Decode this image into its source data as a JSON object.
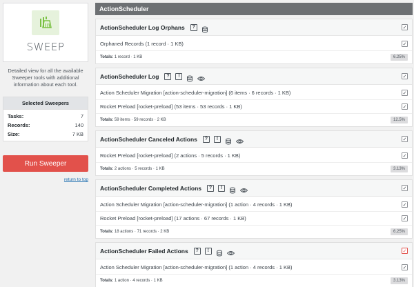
{
  "sidebar": {
    "logo_text": "SWEEP",
    "description": "Detailed view for all the available Sweeper tools with additional information about each tool.",
    "selected_title": "Selected Sweepers",
    "stats": [
      {
        "label": "Tasks:",
        "value": "7"
      },
      {
        "label": "Records:",
        "value": "140"
      },
      {
        "label": "Size:",
        "value": "7 KB"
      }
    ],
    "run_button": "Run Sweeper",
    "return_link": "return to top"
  },
  "main": {
    "title": "ActionScheduler",
    "cards": [
      {
        "title": "ActionScheduler Log Orphans",
        "items": [
          "Orphaned Records (1 record · 1 KB)"
        ],
        "totals_label": "Totals:",
        "totals": "1 record · 1 KB",
        "pct": "6.25%"
      },
      {
        "title": "ActionScheduler Log",
        "items": [
          "Action Scheduler Migration [action-scheduler-migration] (6 items · 6 records · 1 KB)",
          "Rocket Preload [rocket-preload] (53 items · 53 records · 1 KB)"
        ],
        "totals_label": "Totals:",
        "totals": "59 items · 59 records · 2 KB",
        "pct": "12.5%"
      },
      {
        "title": "ActionScheduler Canceled Actions",
        "items": [
          "Rocket Preload [rocket-preload] (2 actions · 5 records · 1 KB)"
        ],
        "totals_label": "Totals:",
        "totals": "2 actions · 5 records · 1 KB",
        "pct": "3.13%"
      },
      {
        "title": "ActionScheduler Completed Actions",
        "items": [
          "Action Scheduler Migration [action-scheduler-migration] (1 action · 4 records · 1 KB)",
          "Rocket Preload [rocket-preload] (17 actions · 67 records · 1 KB)"
        ],
        "totals_label": "Totals:",
        "totals": "18 actions · 71 records · 2 KB",
        "pct": "6.25%"
      },
      {
        "title": "ActionScheduler Failed Actions",
        "items": [
          "Action Scheduler Migration [action-scheduler-migration] (1 action · 4 records · 1 KB)"
        ],
        "totals_label": "Totals:",
        "totals": "1 action · 4 records · 1 KB",
        "pct": "3.13%"
      }
    ]
  },
  "colors": {
    "accent_red": "#e2514b",
    "header_gray": "#6d7073",
    "link_blue": "#2271b1"
  }
}
